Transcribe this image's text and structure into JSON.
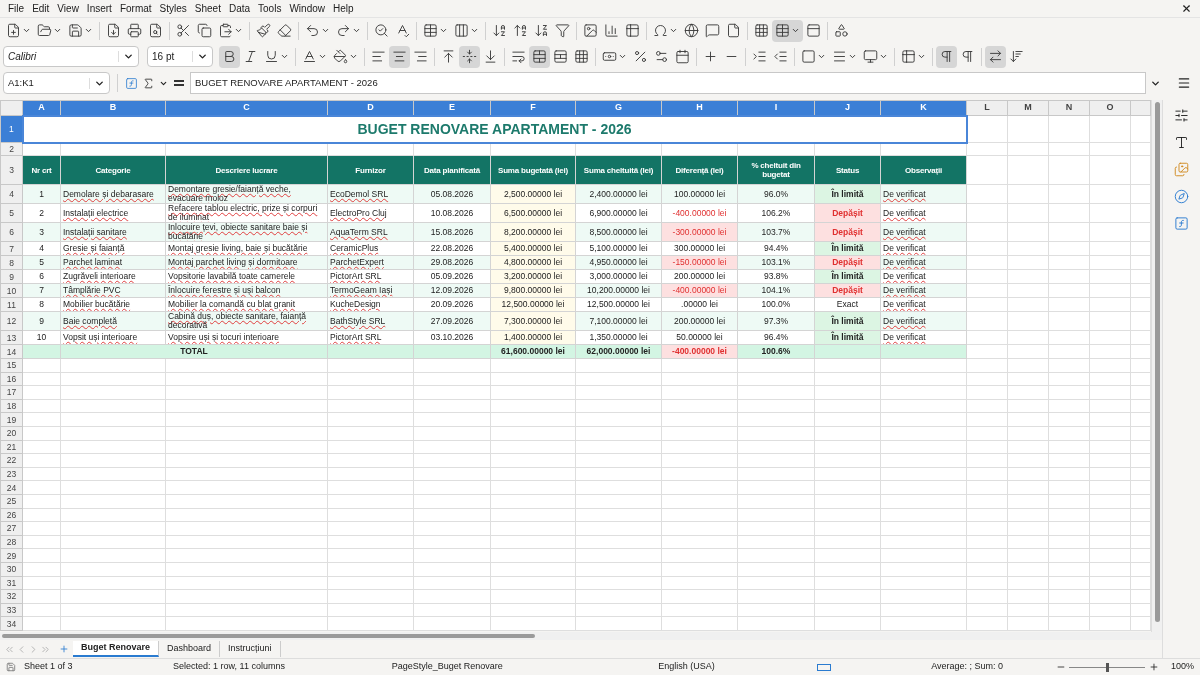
{
  "menu": [
    "File",
    "Edit",
    "View",
    "Insert",
    "Format",
    "Styles",
    "Sheet",
    "Data",
    "Tools",
    "Window",
    "Help"
  ],
  "toolbar": {
    "freeze_active": true
  },
  "format_bar": {
    "font_name": "Calibri",
    "font_size": "16 pt",
    "bold": true,
    "italic": false,
    "underline": false,
    "align_left": false,
    "align_center": true,
    "align_right": false,
    "valign_top": false,
    "valign_center": true,
    "valign_bottom": false,
    "merge": true,
    "ltr": true,
    "wrap_auto": true
  },
  "formula_bar": {
    "name_box": "A1:K1",
    "formula": "BUGET RENOVARE APARTAMENT - 2026"
  },
  "columns": [
    {
      "label": "A",
      "selected": true
    },
    {
      "label": "B",
      "selected": true
    },
    {
      "label": "C",
      "selected": true
    },
    {
      "label": "D",
      "selected": true
    },
    {
      "label": "E",
      "selected": true
    },
    {
      "label": "F",
      "selected": true
    },
    {
      "label": "G",
      "selected": true
    },
    {
      "label": "H",
      "selected": true
    },
    {
      "label": "I",
      "selected": true
    },
    {
      "label": "J",
      "selected": true
    },
    {
      "label": "K",
      "selected": true
    },
    {
      "label": "L",
      "selected": false
    },
    {
      "label": "M",
      "selected": false
    },
    {
      "label": "N",
      "selected": false
    },
    {
      "label": "O",
      "selected": false
    }
  ],
  "row_headers": [
    {
      "label": "1",
      "selected": true
    },
    {
      "label": "2",
      "selected": false
    },
    {
      "label": "3",
      "selected": false
    },
    {
      "label": "4",
      "selected": false
    },
    {
      "label": "5",
      "selected": false
    },
    {
      "label": "6",
      "selected": false
    },
    {
      "label": "7",
      "selected": false
    },
    {
      "label": "8",
      "selected": false
    },
    {
      "label": "9",
      "selected": false
    },
    {
      "label": "10",
      "selected": false
    },
    {
      "label": "11",
      "selected": false
    },
    {
      "label": "12",
      "selected": false
    },
    {
      "label": "13",
      "selected": false
    },
    {
      "label": "14",
      "selected": false
    },
    {
      "label": "15",
      "selected": false
    },
    {
      "label": "16",
      "selected": false
    },
    {
      "label": "17",
      "selected": false
    },
    {
      "label": "18",
      "selected": false
    },
    {
      "label": "19",
      "selected": false
    },
    {
      "label": "20",
      "selected": false
    },
    {
      "label": "21",
      "selected": false
    },
    {
      "label": "22",
      "selected": false
    },
    {
      "label": "23",
      "selected": false
    },
    {
      "label": "24",
      "selected": false
    },
    {
      "label": "25",
      "selected": false
    },
    {
      "label": "26",
      "selected": false
    },
    {
      "label": "27",
      "selected": false
    },
    {
      "label": "28",
      "selected": false
    },
    {
      "label": "29",
      "selected": false
    },
    {
      "label": "30",
      "selected": false
    },
    {
      "label": "31",
      "selected": false
    },
    {
      "label": "32",
      "selected": false
    },
    {
      "label": "33",
      "selected": false
    },
    {
      "label": "34",
      "selected": false
    }
  ],
  "title": "BUGET RENOVARE APARTAMENT - 2026",
  "headers": [
    "Nr crt",
    "Categorie",
    "Descriere lucrare",
    "Furnizor",
    "Data planificată",
    "Suma bugetată (lei)",
    "Suma cheltuită (lei)",
    "Diferență (lei)",
    "% cheltuit din bugetat",
    "Status",
    "Observații"
  ],
  "rows": [
    {
      "nr": "1",
      "categorie": "Demolare și debarasare",
      "descriere": "Demontare gresie/faianță veche, evacuare moloz",
      "furnizor": "EcoDemol SRL",
      "data": "05.08.2026",
      "buget": "2,500.00000 lei",
      "cheltuit": "2,400.00000 lei",
      "diferenta": "100.00000 lei",
      "procent": "96.0%",
      "status": "În limită",
      "kind": "under",
      "observatii": "De verificat"
    },
    {
      "nr": "2",
      "categorie": "Instalații electrice",
      "descriere": "Refacere tablou electric, prize și corpuri de iluminat",
      "furnizor": "ElectroPro Cluj",
      "data": "10.08.2026",
      "buget": "6,500.00000 lei",
      "cheltuit": "6,900.00000 lei",
      "diferenta": "-400.00000 lei",
      "procent": "106.2%",
      "status": "Depășit",
      "kind": "over",
      "observatii": "De verificat"
    },
    {
      "nr": "3",
      "categorie": "Instalații sanitare",
      "descriere": "Înlocuire țevi, obiecte sanitare baie și bucătărie",
      "furnizor": "AquaTerm SRL",
      "data": "15.08.2026",
      "buget": "8,200.00000 lei",
      "cheltuit": "8,500.00000 lei",
      "diferenta": "-300.00000 lei",
      "procent": "103.7%",
      "status": "Depășit",
      "kind": "over",
      "observatii": "De verificat"
    },
    {
      "nr": "4",
      "categorie": "Gresie și faianță",
      "descriere": "Montaj gresie living, baie și bucătărie",
      "furnizor": "CeramicPlus",
      "data": "22.08.2026",
      "buget": "5,400.00000 lei",
      "cheltuit": "5,100.00000 lei",
      "diferenta": "300.00000 lei",
      "procent": "94.4%",
      "status": "În limită",
      "kind": "under",
      "observatii": "De verificat"
    },
    {
      "nr": "5",
      "categorie": "Parchet laminat",
      "descriere": "Montaj parchet living și dormitoare",
      "furnizor": "ParchetExpert",
      "data": "29.08.2026",
      "buget": "4,800.00000 lei",
      "cheltuit": "4,950.00000 lei",
      "diferenta": "-150.00000 lei",
      "procent": "103.1%",
      "status": "Depășit",
      "kind": "over",
      "observatii": "De verificat"
    },
    {
      "nr": "6",
      "categorie": "Zugrăveli interioare",
      "descriere": "Vopsitorie lavabilă toate camerele",
      "furnizor": "PictorArt SRL",
      "data": "05.09.2026",
      "buget": "3,200.00000 lei",
      "cheltuit": "3,000.00000 lei",
      "diferenta": "200.00000 lei",
      "procent": "93.8%",
      "status": "În limită",
      "kind": "under",
      "observatii": "De verificat"
    },
    {
      "nr": "7",
      "categorie": "Tâmplărie PVC",
      "descriere": "Înlocuire ferestre și uși balcon",
      "furnizor": "TermoGeam Iași",
      "data": "12.09.2026",
      "buget": "9,800.00000 lei",
      "cheltuit": "10,200.00000 lei",
      "diferenta": "-400.00000 lei",
      "procent": "104.1%",
      "status": "Depășit",
      "kind": "over",
      "observatii": "De verificat"
    },
    {
      "nr": "8",
      "categorie": "Mobilier bucătărie",
      "descriere": "Mobilier la comandă cu blat granit",
      "furnizor": "KucheDesign",
      "data": "20.09.2026",
      "buget": "12,500.00000 lei",
      "cheltuit": "12,500.00000 lei",
      "diferenta": ".00000 lei",
      "procent": "100.0%",
      "status": "Exact",
      "kind": "exact",
      "observatii": "De verificat"
    },
    {
      "nr": "9",
      "categorie": "Baie completă",
      "descriere": "Cabină duș, obiecte sanitare, faianță decorativă",
      "furnizor": "BathStyle SRL",
      "data": "27.09.2026",
      "buget": "7,300.00000 lei",
      "cheltuit": "7,100.00000 lei",
      "diferenta": "200.00000 lei",
      "procent": "97.3%",
      "status": "În limită",
      "kind": "under",
      "observatii": "De verificat"
    },
    {
      "nr": "10",
      "categorie": "Vopsit uși interioare",
      "descriere": "Vopsire uși și tocuri interioare",
      "furnizor": "PictorArt SRL",
      "data": "03.10.2026",
      "buget": "1,400.00000 lei",
      "cheltuit": "1,350.00000 lei",
      "diferenta": "50.00000 lei",
      "procent": "96.4%",
      "status": "În limită",
      "kind": "under",
      "observatii": "De verificat"
    }
  ],
  "total": {
    "label": "TOTAL",
    "buget": "61,600.00000 lei",
    "cheltuit": "62,000.00000 lei",
    "diferenta": "-400.00000 lei",
    "procent": "100.6%",
    "kind": "over"
  },
  "sheet_tabs": [
    {
      "label": "Buget Renovare",
      "selected": true
    },
    {
      "label": "Dashboard",
      "selected": false
    },
    {
      "label": "Instrucțiuni",
      "selected": false
    }
  ],
  "status_bar": {
    "sheet": "Sheet 1 of 3",
    "selection": "Selected: 1 row, 11 columns",
    "page_style": "PageStyle_Buget Renovare",
    "language": "English (USA)",
    "sum": "Average: ; Sum: 0",
    "zoom": "100%",
    "zoom_slider": {
      "level": 0.5
    }
  }
}
